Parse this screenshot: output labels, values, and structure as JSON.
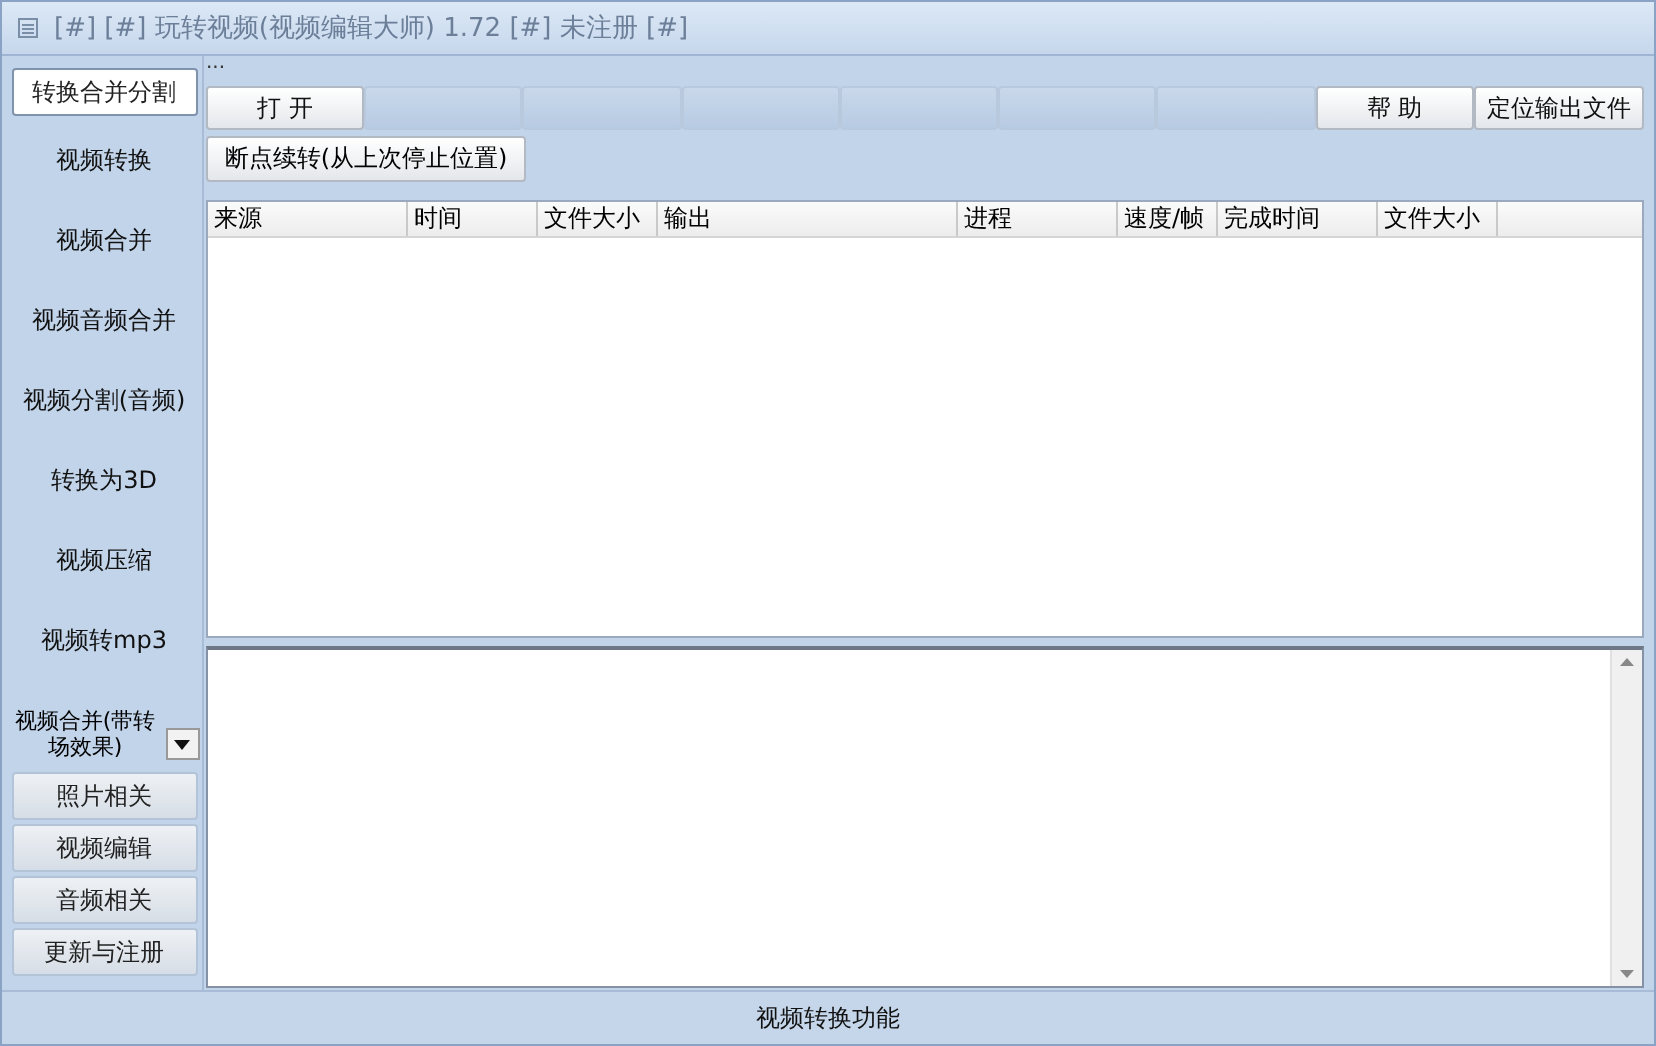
{
  "window": {
    "title": "[#] [#] 玩转视频(视频编辑大师) 1.72 [#] 未注册 [#]"
  },
  "sidebar": {
    "top_tab": {
      "label": "转换合并分割",
      "selected": true
    },
    "items": [
      {
        "label": "视频转换"
      },
      {
        "label": "视频合并"
      },
      {
        "label": "视频音频合并"
      },
      {
        "label": "视频分割(音频)"
      },
      {
        "label": "转换为3D"
      },
      {
        "label": "视频压缩"
      },
      {
        "label": "视频转mp3"
      },
      {
        "label": "视频合并(带转场效果)",
        "kind": "dropdown"
      }
    ],
    "buttons": [
      "照片相关",
      "视频编辑",
      "音频相关",
      "更新与注册"
    ]
  },
  "ellipsis": "...",
  "toolbar": [
    {
      "label": "打 开",
      "disabled": false
    },
    {
      "disabled": true
    },
    {
      "disabled": true
    },
    {
      "disabled": true
    },
    {
      "disabled": true
    },
    {
      "disabled": true
    },
    {
      "disabled": true
    },
    {
      "label": "帮 助",
      "disabled": false
    },
    {
      "label": "定位输出文件",
      "disabled": false
    }
  ],
  "resume_button": "断点续转(从上次停止位置)",
  "table": {
    "columns": [
      "来源",
      "时间",
      "文件大小",
      "输出",
      "进程",
      "速度/帧",
      "完成时间",
      "文件大小"
    ]
  },
  "status_bar": "视频转换功能"
}
